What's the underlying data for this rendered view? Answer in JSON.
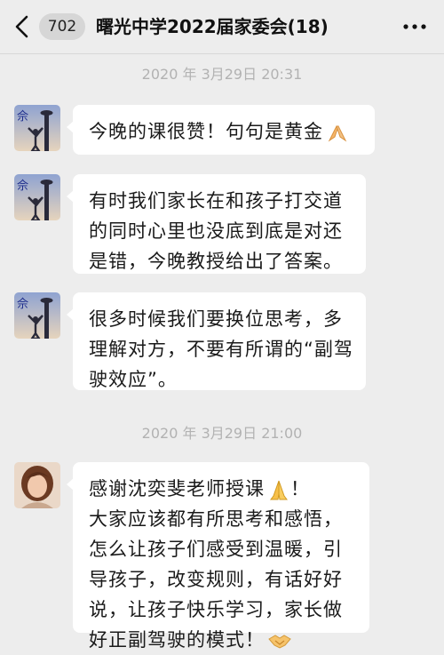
{
  "header": {
    "unread_count": "702",
    "chat_title": "曙光中学2022届家委会(18)"
  },
  "timestamps": [
    "2020 年 3月29日 20:31",
    "2020 年 3月29日 21:00"
  ],
  "avatar_a": {
    "initial": "佘",
    "colors": {
      "sky_top": "#9fb0d6",
      "sky_bottom": "#e7d9c6",
      "silhouette": "#2a2a3a"
    }
  },
  "messages": [
    {
      "lines": [
        "今晚的课很赞！句句是黄金"
      ],
      "trailing_icon": "praise-hands-icon"
    },
    {
      "lines": [
        "有时我们家长在和孩子打交道",
        "的同时心里也没底到底是对还",
        "是错，今晚教授给出了答案。"
      ]
    },
    {
      "lines": [
        "很多时候我们要换位思考，多",
        "理解对方，不要有所谓的“副驾",
        "驶效应”。"
      ]
    },
    {
      "lines": [
        "感谢沈奕斐老师授课",
        "大家应该都有所思考和感悟，",
        "怎么让孩子们感受到温暖，引",
        "导孩子，改变规则，有话好好",
        "说，让孩子快乐学习，家长做",
        "好正副驾驶的模式！"
      ],
      "first_line_icon": "folded-hands-icon",
      "first_line_suffix": "！",
      "last_line_icon": "handshake-icon"
    }
  ]
}
